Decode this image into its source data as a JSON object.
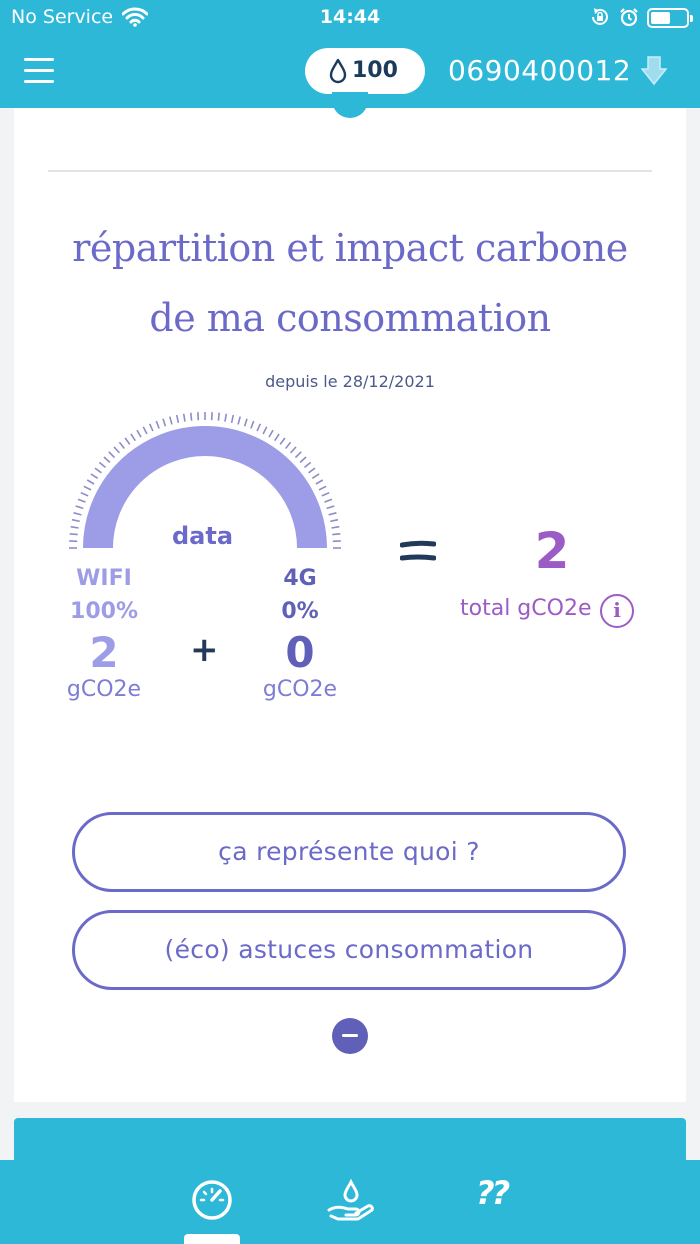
{
  "status_bar": {
    "carrier": "No Service",
    "time": "14:44"
  },
  "header": {
    "credit_value": "100",
    "phone_number": "0690400012"
  },
  "card": {
    "title_line1": "répartition et impact carbone",
    "title_line2": "de ma consommation",
    "since": "depuis le 28/12/2021",
    "gauge": {
      "label": "data",
      "wifi_share": 1.0,
      "wifi_color": "#9d9ce6",
      "lte_color": "#6060b8"
    },
    "wifi": {
      "label": "WIFI",
      "percent": "100%",
      "value": "2",
      "unit": "gCO2e"
    },
    "lte": {
      "label": "4G",
      "percent": "0%",
      "value": "0",
      "unit": "gCO2e"
    },
    "plus": "+",
    "total": {
      "value": "2",
      "label": "total gCO2e",
      "info_icon": "i"
    },
    "buttons": {
      "what_it_means": "ça représente quoi ?",
      "eco_tips": "(éco) astuces consommation"
    }
  },
  "colors": {
    "primary": "#2db8d8",
    "accent": "#6b6ac8",
    "total": "#9b5cc6",
    "dark": "#22395a"
  },
  "tabs": {
    "help_label": "??"
  }
}
